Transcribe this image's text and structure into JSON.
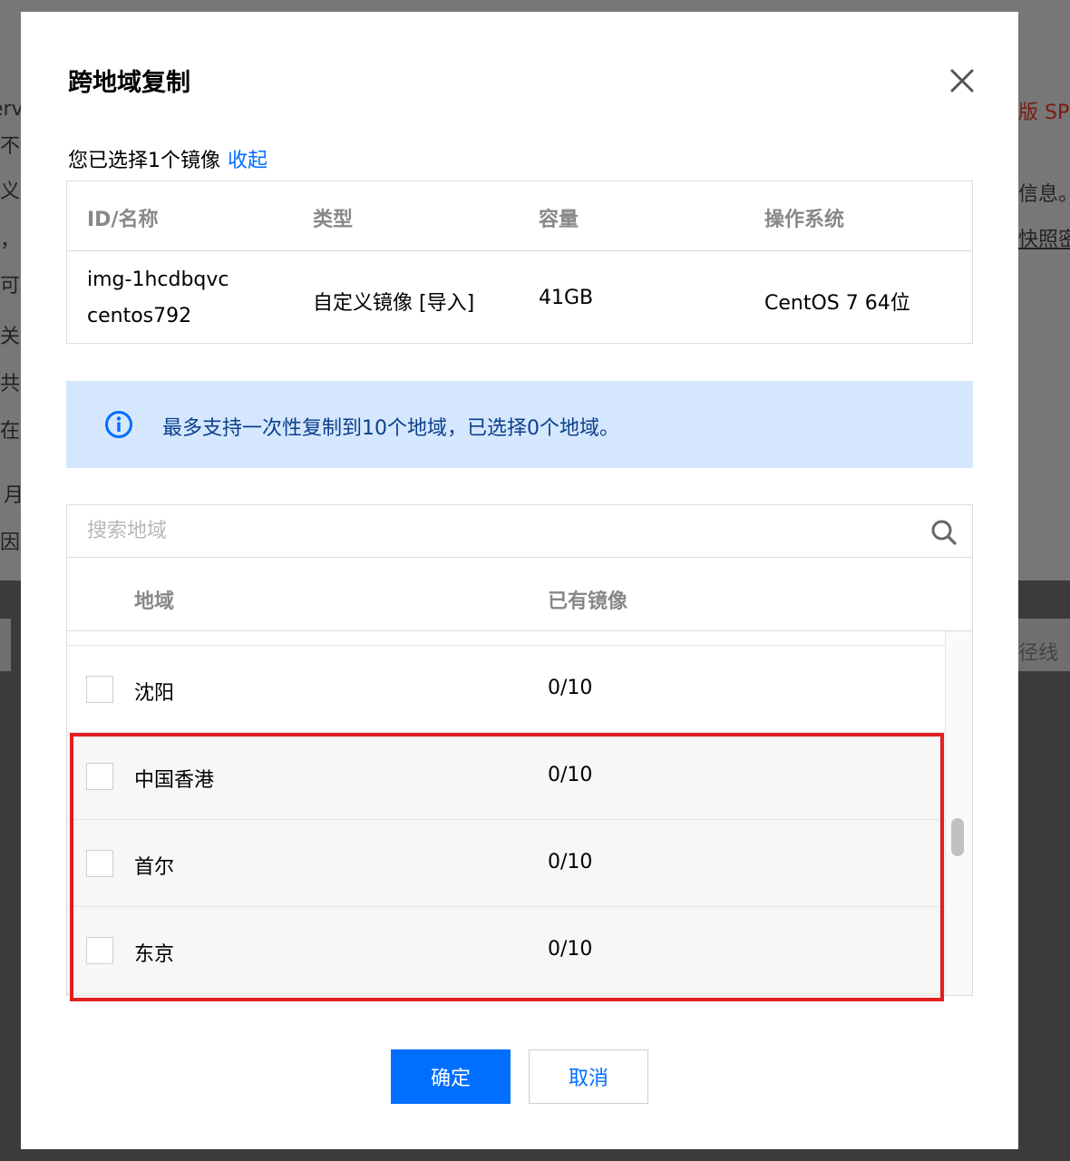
{
  "background": {
    "fragments_left": [
      "erv",
      "不",
      "义",
      "，",
      "可",
      "关",
      "共",
      "在",
      "月",
      "因"
    ],
    "fragments_right": [
      "版 SP",
      "信息。",
      "快照密",
      "径线"
    ]
  },
  "dialog": {
    "title": "跨地域复制",
    "close_icon": "close-icon",
    "selection_text": "您已选择1个镜像",
    "collapse_link": "收起",
    "image_table": {
      "headers": [
        "ID/名称",
        "类型",
        "容量",
        "操作系统"
      ],
      "row": {
        "id": "img-1hcdbqvc",
        "name": "centos792",
        "type": "自定义镜像 [导入]",
        "capacity": "41GB",
        "os": "CentOS 7 64位"
      }
    },
    "info": {
      "icon": "info-icon",
      "text": "最多支持一次性复制到10个地域，已选择0个地域。"
    },
    "region_picker": {
      "search_placeholder": "搜索地域",
      "search_icon": "search-icon",
      "headers": [
        "地域",
        "已有镜像"
      ],
      "rows": [
        {
          "region": "沈阳",
          "count": "0/10",
          "checked": false
        },
        {
          "region": "中国香港",
          "count": "0/10",
          "checked": false
        },
        {
          "region": "首尔",
          "count": "0/10",
          "checked": false
        },
        {
          "region": "东京",
          "count": "0/10",
          "checked": false
        }
      ]
    },
    "confirm_label": "确定",
    "cancel_label": "取消",
    "colors": {
      "primary": "#006eff",
      "info_bg": "#d5e7fe",
      "annotation": "#e02020"
    }
  }
}
